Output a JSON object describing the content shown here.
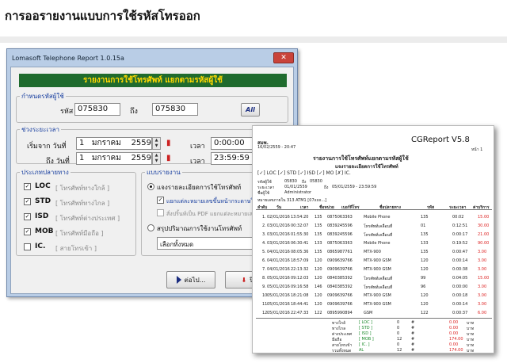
{
  "page_title": "การออรายงานแบบการใช้รหัสโทรออก",
  "window": {
    "title": "Lomasoft Telephone Report 1.0.15a",
    "close_label": "✕",
    "banner": "รายงานการใช้โทรศัพท์ แยกตามรหัสผู้ใช้",
    "user_group": {
      "legend": "กำหนดรหัสผู้ใช้",
      "from_label": "รหัส",
      "from_value": "075830",
      "to_label": "ถึง",
      "to_value": "075830",
      "all_button": "All"
    },
    "date_group": {
      "legend": "ช่วงระยะเวลา",
      "start_label": "เริ่มจาก วันที่",
      "start_day": "1",
      "start_month": "มกราคม",
      "start_year": "2559",
      "start_time_label": "เวลา",
      "start_time": "0:00:00",
      "end_label": "ถึง วันที่",
      "end_day": "1",
      "end_month": "มกราคม",
      "end_year": "2559",
      "end_time_label": "เวลา",
      "end_time": "23:59:59"
    },
    "dest_group": {
      "legend": "ประเภทปลายทาง",
      "items": [
        {
          "code": "LOC",
          "desc": "[ โทรศัพท์ทางใกล้ ]",
          "checked": true
        },
        {
          "code": "STD",
          "desc": "[ โทรศัพท์ทางไกล ]",
          "checked": true
        },
        {
          "code": "ISD",
          "desc": "[ โทรศัพท์ต่างประเทศ ]",
          "checked": true
        },
        {
          "code": "MOB",
          "desc": "[ โทรศัพท์มือถือ ]",
          "checked": true
        },
        {
          "code": "IC.",
          "desc": "[ สายโทรเข้า ]",
          "checked": false
        }
      ]
    },
    "report_group": {
      "legend": "แบบรายงาน",
      "option1": "แจงรายละเอียดการใช้โทรศัพท์",
      "sub1": "แยกแต่ละหมายเลขขึ้นหน้ากระดาษใหม่",
      "sub2": "สั่งปริ้นท์เป็น PDF แยกแต่ละหมายเลข",
      "option2": "สรุปปริมาณการใช้งานโทรศัพท์",
      "select_value": "เลือกทั้งหมด"
    },
    "next_button": "ต่อไป...",
    "close_button": "ปิด"
  },
  "report": {
    "org": "สมพ.",
    "datetime": "16/02/2559 - 20:47",
    "product": "CGReport V5.8",
    "page": "หน้า 1",
    "title1": "รายงานการใช้โทรศัพท์แยกตามรหัสผู้ใช้",
    "title2": "แจงรายละเอียดการใช้โทรศัพท์",
    "filters": "[✓] LOC [✓] STD [✓] ISD [✓] MO [✗] IC.",
    "user_code_label": "รหัสผู้ใช้",
    "user_code": "05830",
    "user_to_label": "ถึง",
    "user_to": "05830",
    "period_label": "ระยะเวลา",
    "period_start": "01/01/2559",
    "period_end_label": "ถึง",
    "period_end": "05/01/2559 - 23:59:59",
    "name_label": "ชื่อผู้ใช้",
    "name": "Administrator",
    "summary": "หมายเลขภายใน 313     ATM1    [07xxx...]",
    "headers": [
      "ลำดับ",
      "วัน",
      "เวลา",
      "ชื่อหน่วย",
      "เบอร์ที่โทร",
      "ชื่อปลายทาง",
      "รหัส",
      "ระยะเวลา",
      "ค่าบริการ"
    ],
    "rows": [
      [
        "1.",
        "02/01/2016",
        "13:54:20",
        "135",
        "0875063363",
        "Mobile Phone",
        "135",
        "00:02",
        "15.00"
      ],
      [
        "2.",
        "03/01/2016",
        "00:32:07",
        "135",
        "0839245596",
        "โทรศัพท์เคลื่อนที่",
        "01",
        "0:12:51",
        "30.00"
      ],
      [
        "3.",
        "03/01/2016",
        "01:55:30",
        "135",
        "0839245596",
        "โทรศัพท์เคลื่อนที่",
        "135",
        "0:00:17",
        "21.00"
      ],
      [
        "4.",
        "03/01/2016",
        "06:30:41",
        "133",
        "0875063363",
        "Mobile Phone",
        "133",
        "0:19:52",
        "90.00"
      ],
      [
        "5.",
        "04/01/2016",
        "08:05:36",
        "135",
        "0865987761",
        "MTX-900",
        "135",
        "0:00:47",
        "3.00"
      ],
      [
        "6.",
        "04/01/2016",
        "18:57:09",
        "120",
        "0909639766",
        "MTX-900 GSM",
        "120",
        "0:00:14",
        "3.00"
      ],
      [
        "7.",
        "04/01/2016",
        "22:13:32",
        "120",
        "0909639766",
        "MTX-900 GSM",
        "120",
        "0:00:38",
        "3.00"
      ],
      [
        "8.",
        "05/01/2016",
        "09:12:03",
        "120",
        "0840385392",
        "โทรศัพท์เคลื่อนที่",
        "99",
        "0:04:05",
        "15.00"
      ],
      [
        "9.",
        "05/01/2016",
        "09:16:58",
        "146",
        "0840385392",
        "โทรศัพท์เคลื่อนที่",
        "96",
        "0:00:00",
        "3.00"
      ],
      [
        "10.",
        "05/01/2016",
        "18:21:08",
        "120",
        "0909639766",
        "MTX-900 GSM",
        "120",
        "0:00:18",
        "3.00"
      ],
      [
        "11.",
        "05/01/2016",
        "18:44:41",
        "120",
        "0909639766",
        "MTX-900 GSM",
        "120",
        "0:00:14",
        "3.00"
      ],
      [
        "12.",
        "05/01/2016",
        "22:47:33",
        "122",
        "0895990894",
        "GSM",
        "122",
        "0:00:37",
        "6.00"
      ]
    ],
    "totals": [
      {
        "label": "ทางใกล้",
        "code": "[ LOC ]",
        "count": "0",
        "unit": "#",
        "amount": "0.00",
        "baht": "บาท"
      },
      {
        "label": "ทางไกล",
        "code": "[ STD ]",
        "count": "0",
        "unit": "#",
        "amount": "0.00",
        "baht": "บาท"
      },
      {
        "label": "ต่างประเทศ",
        "code": "[ ISD ]",
        "count": "0",
        "unit": "#",
        "amount": "0.00",
        "baht": "บาท"
      },
      {
        "label": "มือถือ",
        "code": "[ MOB ]",
        "count": "12",
        "unit": "#",
        "amount": "174.00",
        "baht": "บาท"
      },
      {
        "label": "สายโทรเข้า",
        "code": "[ IC. ]",
        "count": "0",
        "unit": "#",
        "amount": "0.00",
        "baht": "บาท"
      },
      {
        "label": "รวมทั้งหมด",
        "code": "AL",
        "count": "12",
        "unit": "#",
        "amount": "174.00",
        "baht": "บาท"
      }
    ]
  }
}
